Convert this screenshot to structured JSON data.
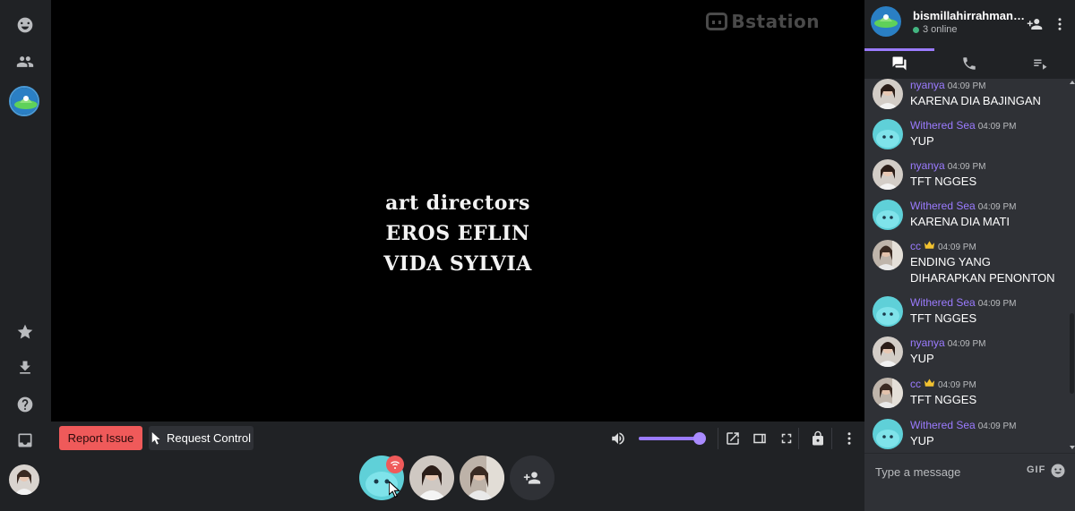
{
  "video": {
    "watermark": "Bstation",
    "credits": [
      "art directors",
      "EROS EFLIN",
      "VIDA SYLVIA"
    ]
  },
  "controls": {
    "report_label": "Report Issue",
    "request_label": "Request Control",
    "volume_percent": 100
  },
  "colors": {
    "accent": "#9b7bff",
    "report": "#ef5a5a",
    "online": "#43b581"
  },
  "room": {
    "name": "bismillahirrahmanirr...",
    "online": "3 online"
  },
  "messages": [
    {
      "author": "nyanya",
      "time": "04:09 PM",
      "text": "KARENA DIA BAJINGAN",
      "avatar": "girl",
      "crown": false
    },
    {
      "author": "Withered Sea",
      "time": "04:09 PM",
      "text": "YUP",
      "avatar": "blob",
      "crown": false
    },
    {
      "author": "nyanya",
      "time": "04:09 PM",
      "text": "TFT NGGES",
      "avatar": "girl",
      "crown": false
    },
    {
      "author": "Withered Sea",
      "time": "04:09 PM",
      "text": "KARENA DIA MATI",
      "avatar": "blob",
      "crown": false
    },
    {
      "author": "cc",
      "time": "04:09 PM",
      "text": "ENDING YANG DIHARAPKAN PENONTON",
      "avatar": "girl2",
      "crown": true
    },
    {
      "author": "Withered Sea",
      "time": "04:09 PM",
      "text": "TFT NGGES",
      "avatar": "blob",
      "crown": false
    },
    {
      "author": "nyanya",
      "time": "04:09 PM",
      "text": "YUP",
      "avatar": "girl",
      "crown": false
    },
    {
      "author": "cc",
      "time": "04:09 PM",
      "text": "TFT NGGES",
      "avatar": "girl2",
      "crown": true
    },
    {
      "author": "Withered Sea",
      "time": "04:09 PM",
      "text": "YUP",
      "avatar": "blob",
      "crown": false
    }
  ],
  "composer": {
    "placeholder": "Type a message",
    "gif_label": "GIF"
  }
}
